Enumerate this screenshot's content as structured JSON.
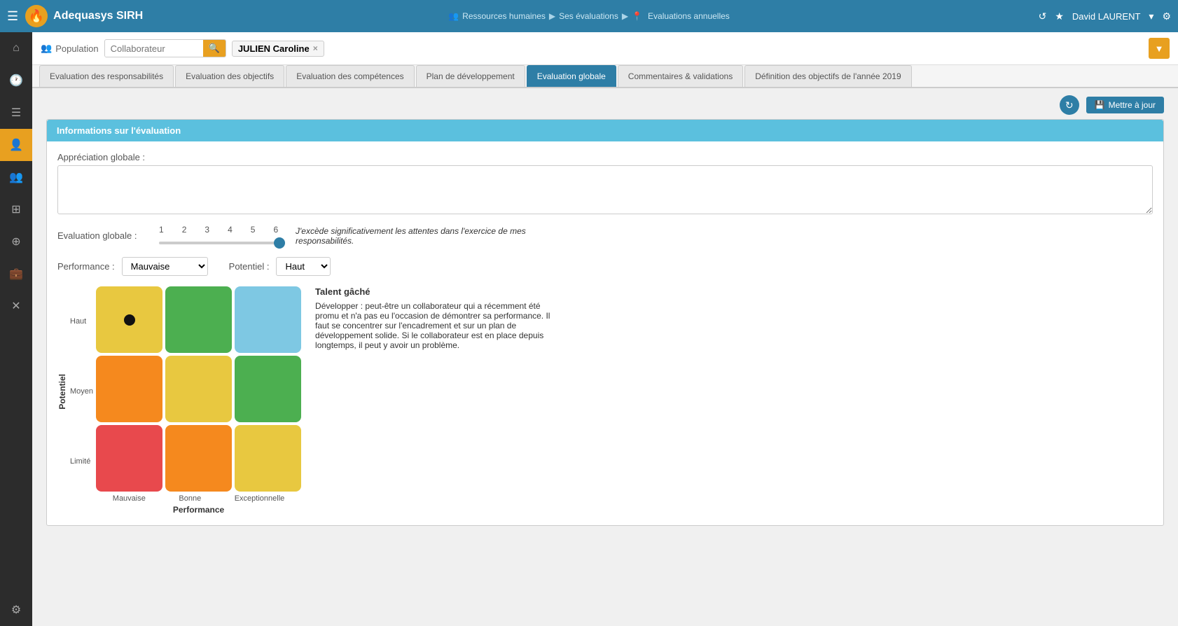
{
  "app": {
    "title": "Adequasys SIRH",
    "logo_char": "🔥"
  },
  "breadcrumb": {
    "items": [
      "Ressources humaines",
      "Ses évaluations",
      "Evaluations annuelles"
    ],
    "separators": [
      "▶",
      "▶"
    ],
    "pin": "📍"
  },
  "top_right": {
    "refresh_icon": "↺",
    "star_icon": "★",
    "user": "David LAURENT",
    "chevron": "▾",
    "gear_icon": "⚙"
  },
  "sidebar": {
    "items": [
      {
        "icon": "⌂",
        "name": "home",
        "active": false
      },
      {
        "icon": "🕐",
        "name": "clock",
        "active": false
      },
      {
        "icon": "≡",
        "name": "list",
        "active": false
      },
      {
        "icon": "👤",
        "name": "person",
        "active": true
      },
      {
        "icon": "👥",
        "name": "group",
        "active": false
      },
      {
        "icon": "⊞",
        "name": "grid",
        "active": false
      },
      {
        "icon": "⊕",
        "name": "plus-circle",
        "active": false
      },
      {
        "icon": "💼",
        "name": "briefcase",
        "active": false
      },
      {
        "icon": "✕",
        "name": "cross",
        "active": false
      }
    ],
    "bottom": [
      {
        "icon": "⚙",
        "name": "settings"
      }
    ]
  },
  "search_row": {
    "population_label": "Population",
    "population_icon": "👥",
    "input_placeholder": "Collaborateur",
    "search_icon": "🔍",
    "tag_name": "JULIEN Caroline",
    "tag_close": "×"
  },
  "tabs": [
    {
      "label": "Evaluation des responsabilités",
      "active": false
    },
    {
      "label": "Evaluation des objectifs",
      "active": false
    },
    {
      "label": "Evaluation des compétences",
      "active": false
    },
    {
      "label": "Plan de développement",
      "active": false
    },
    {
      "label": "Evaluation globale",
      "active": true
    },
    {
      "label": "Commentaires & validations",
      "active": false
    },
    {
      "label": "Définition des objectifs de l'année 2019",
      "active": false
    }
  ],
  "page": {
    "refresh_btn_icon": "↻",
    "update_btn_icon": "💾",
    "update_btn_label": "Mettre à jour",
    "info_section_title": "Informations sur l'évaluation",
    "appreciation_label": "Appréciation globale :",
    "appreciation_placeholder": "",
    "evaluation_globale_label": "Evaluation globale :",
    "slider": {
      "numbers": [
        "1",
        "2",
        "3",
        "4",
        "5",
        "6"
      ],
      "value": 6,
      "text": "J'excède significativement les attentes dans l'exercice de mes responsabilités."
    },
    "performance_label": "Performance :",
    "performance_options": [
      "Mauvaise",
      "Bonne",
      "Exceptionnelle"
    ],
    "performance_selected": "Mauvaise",
    "potentiel_label": "Potentiel :",
    "potentiel_options": [
      "Limité",
      "Moyen",
      "Haut"
    ],
    "potentiel_selected": "Haut",
    "matrix": {
      "cells": [
        {
          "row": 0,
          "col": 0,
          "color": "#e8c840",
          "has_dot": true
        },
        {
          "row": 0,
          "col": 1,
          "color": "#4caf50"
        },
        {
          "row": 0,
          "col": 2,
          "color": "#7ec8e3"
        },
        {
          "row": 1,
          "col": 0,
          "color": "#f5891e"
        },
        {
          "row": 1,
          "col": 1,
          "color": "#e8c840"
        },
        {
          "row": 1,
          "col": 2,
          "color": "#4caf50"
        },
        {
          "row": 2,
          "col": 0,
          "color": "#e8494d"
        },
        {
          "row": 2,
          "col": 1,
          "color": "#f5891e"
        },
        {
          "row": 2,
          "col": 2,
          "color": "#e8c840"
        }
      ],
      "y_axis_label": "Potentiel",
      "y_labels": [
        "Haut",
        "Moyen",
        "Limité"
      ],
      "x_axis_label": "Performance",
      "x_labels": [
        "Mauvaise",
        "Bonne",
        "Exceptionnelle"
      ]
    },
    "description_title": "Talent gâché",
    "description_text": "Développer : peut-être un collaborateur qui a récemment été promu et n'a pas eu l'occasion de démontrer sa performance. Il faut se concentrer sur l'encadrement et sur un plan de développement solide. Si le collaborateur est en place depuis longtemps, il peut y avoir un problème."
  }
}
